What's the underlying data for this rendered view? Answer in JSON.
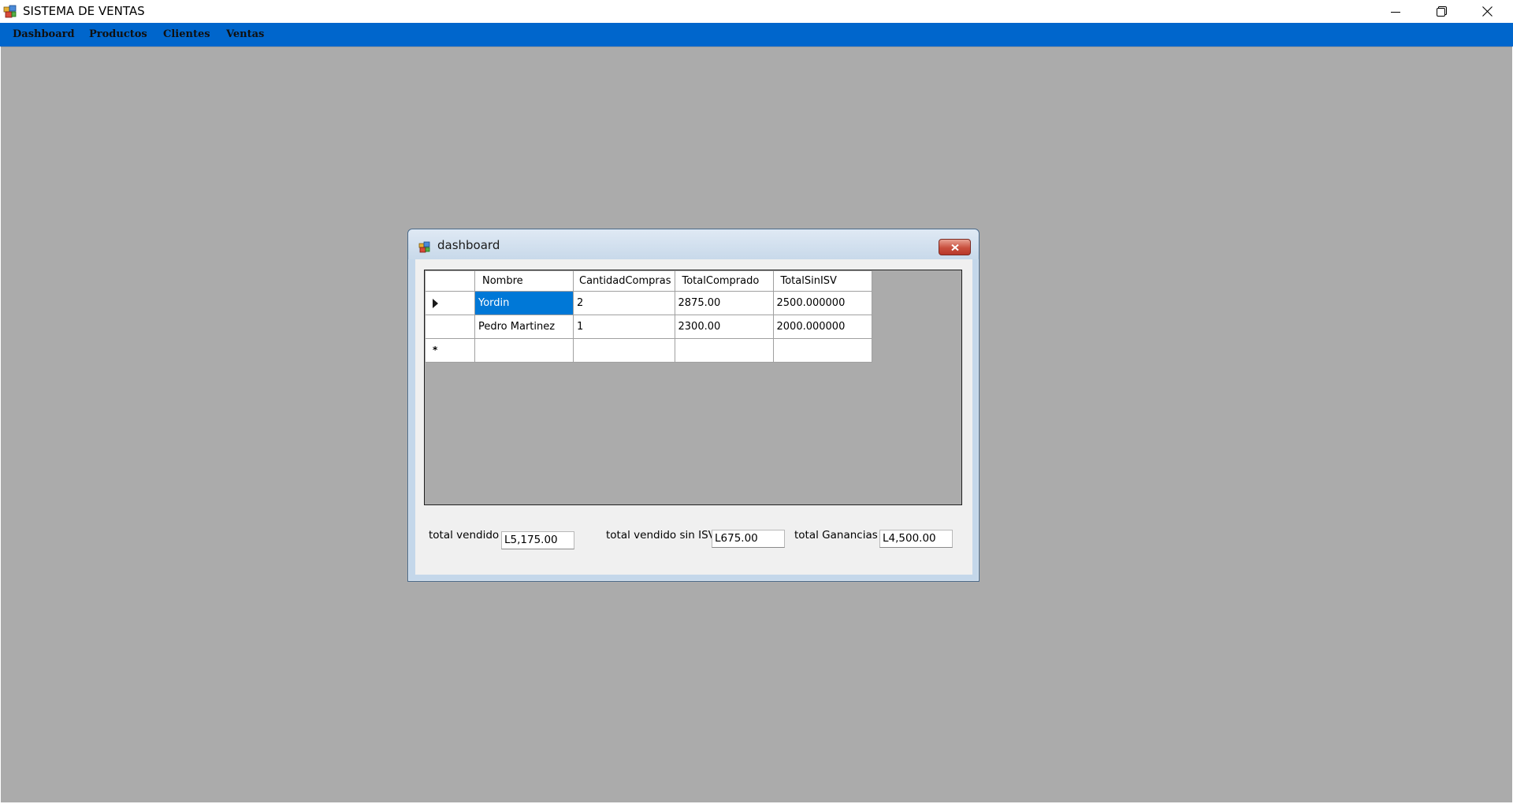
{
  "window": {
    "title": "SISTEMA DE VENTAS",
    "icons": {
      "app": "app-window-icon",
      "minimize": "minimize-icon",
      "restore": "restore-icon",
      "close": "close-icon"
    }
  },
  "menu": {
    "items": [
      {
        "label": "Dashboard"
      },
      {
        "label": "Productos"
      },
      {
        "label": "Clientes"
      },
      {
        "label": "Ventas"
      }
    ],
    "background_color": "#0066cc"
  },
  "mdi_background_color": "#ababab",
  "child_window": {
    "title": "dashboard",
    "grid": {
      "columns": [
        "Nombre",
        "CantidadCompras",
        "TotalComprado",
        "TotalSinISV"
      ],
      "rows": [
        [
          "Yordin",
          "2",
          "2875.00",
          "2500.000000"
        ],
        [
          "Pedro Martinez",
          "1",
          "2300.00",
          "2000.000000"
        ]
      ],
      "new_row_marker": "*",
      "selected_color": "#0078d7"
    },
    "totals": {
      "total_vendido_label": "total vendido",
      "total_vendido_value": "L5,175.00",
      "total_sin_isv_label": "total vendido sin ISV",
      "total_sin_isv_value": "L675.00",
      "total_ganancias_label": "total Ganancias",
      "total_ganancias_value": "L4,500.00"
    }
  }
}
